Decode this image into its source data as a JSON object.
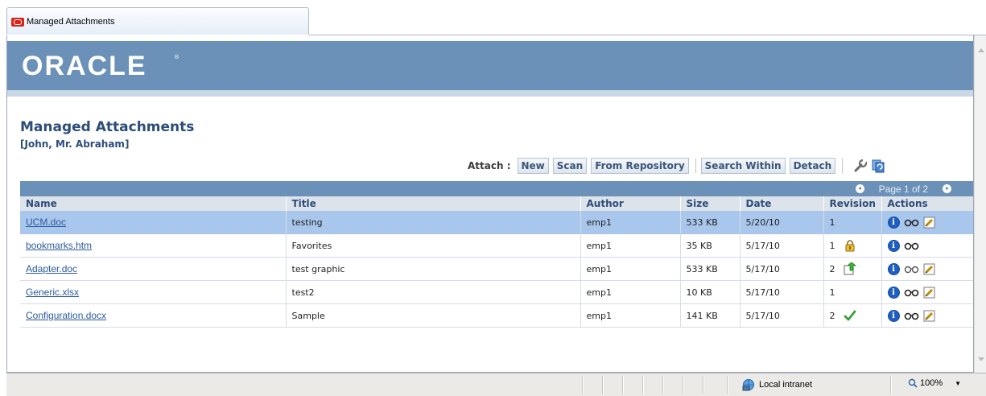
{
  "browser": {
    "tab_title": "Managed Attachments",
    "status_zone": "Local intranet",
    "zoom": "100%"
  },
  "banner": {
    "logo": "ORACLE",
    "logo_mark": "®"
  },
  "page": {
    "title": "Managed Attachments",
    "subtitle": "[John, Mr. Abraham]"
  },
  "toolbar": {
    "attach_label": "Attach :",
    "new": "New",
    "scan": "Scan",
    "from_repository": "From Repository",
    "search_within": "Search Within",
    "detach": "Detach"
  },
  "pager": {
    "text": "Page 1 of 2"
  },
  "table": {
    "columns": [
      "Name",
      "Title",
      "Author",
      "Size",
      "Date",
      "Revision",
      "Actions"
    ],
    "rows": [
      {
        "name": "UCM.doc",
        "title": "testing",
        "author": "emp1",
        "size": "533 KB",
        "date": "5/20/10",
        "revision": "1",
        "status_icon": "",
        "actions": [
          "info-icon",
          "view-icon",
          "edit-icon"
        ],
        "selected": true
      },
      {
        "name": "bookmarks.htm",
        "title": "Favorites",
        "author": "emp1",
        "size": "35 KB",
        "date": "5/17/10",
        "revision": "1",
        "status_icon": "lock-icon",
        "actions": [
          "info-icon",
          "view-icon"
        ],
        "selected": false
      },
      {
        "name": "Adapter.doc",
        "title": "test graphic",
        "author": "emp1",
        "size": "533 KB",
        "date": "5/17/10",
        "revision": "2",
        "status_icon": "update-icon",
        "actions": [
          "info-icon",
          "view-icon",
          "edit-icon"
        ],
        "selected": false
      },
      {
        "name": "Generic.xlsx",
        "title": "test2",
        "author": "emp1",
        "size": "10 KB",
        "date": "5/17/10",
        "revision": "1",
        "status_icon": "",
        "actions": [
          "info-icon",
          "view-icon",
          "edit-icon"
        ],
        "selected": false
      },
      {
        "name": "Configuration.docx",
        "title": "Sample",
        "author": "emp1",
        "size": "141 KB",
        "date": "5/17/10",
        "revision": "2",
        "status_icon": "checkmark-icon",
        "actions": [
          "info-icon",
          "view-icon",
          "edit-icon"
        ],
        "selected": false
      }
    ]
  },
  "colors": {
    "banner": "#6b91b8",
    "selected_row": "#a9c6ec",
    "link": "#2c5aa0",
    "title": "#2c4c7a"
  }
}
